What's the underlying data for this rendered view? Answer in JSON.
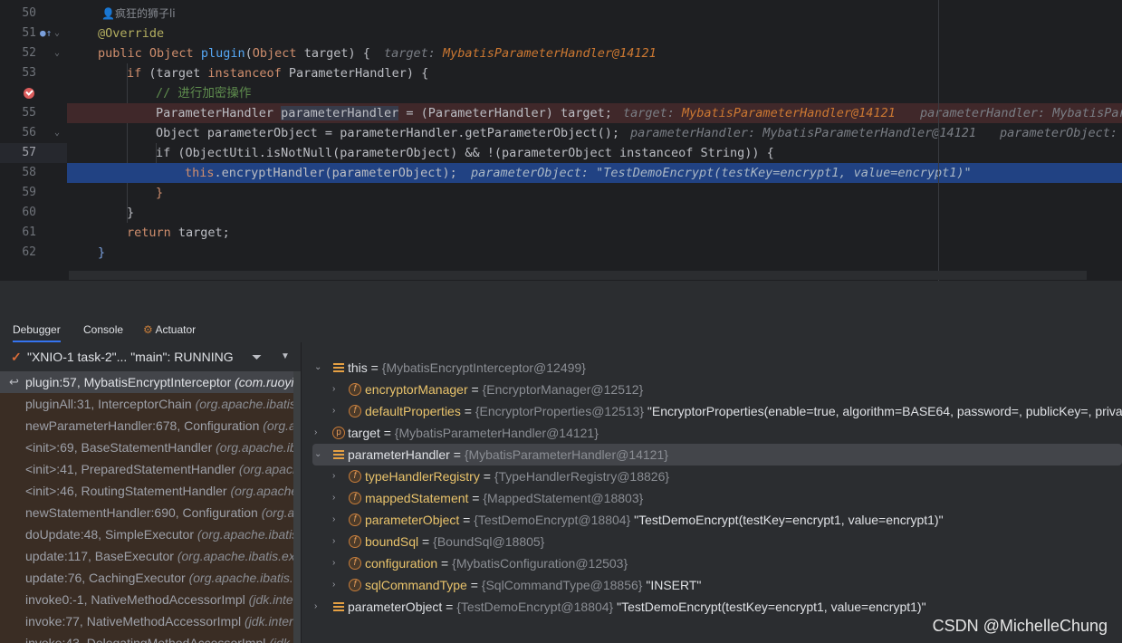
{
  "editor": {
    "author": "疯狂的狮子li",
    "line_numbers": [
      "50",
      "51",
      "52",
      "53",
      "",
      "55",
      "56",
      "57",
      "58",
      "59",
      "60",
      "61",
      "62"
    ],
    "lines": {
      "l50": {
        "annotation": "@Override"
      },
      "l51": {
        "kw_public": "public",
        "type_object": "Object",
        "method": "plugin",
        "open": "(",
        "param_type": "Object",
        "param_name": "target",
        "close": ") {",
        "hint_name": "target: ",
        "hint_value": "MybatisParameterHandler@14121"
      },
      "l52": {
        "kw_if": "if",
        "open": " (target ",
        "kw_instanceof": "instanceof",
        "type": " ParameterHandler",
        "close": ") {"
      },
      "l53": {
        "comment": "// 进行加密操作"
      },
      "l54": {
        "type": "ParameterHandler ",
        "var": "parameterHandler",
        "rest": " = (ParameterHandler) target;",
        "hint1_name": "target: ",
        "hint1_value": "MybatisParameterHandler@14121",
        "hint2": "parameterHandler: MybatisPar"
      },
      "l55": {
        "code": "Object parameterObject = parameterHandler.getParameterObject();",
        "hint1": "parameterHandler: MybatisParameterHandler@14121",
        "hint2": "parameterObject: "
      },
      "l56": {
        "code": "if (ObjectUtil.isNotNull(parameterObject) && !(parameterObject instanceof String)) {"
      },
      "l57": {
        "kw_this": "this",
        "call": ".encryptHandler(",
        "arg": "parameterObject",
        "close": ");",
        "hint": "parameterObject: \"TestDemoEncrypt(testKey=encrypt1, value=encrypt1)\""
      },
      "l58": {
        "code": "}"
      },
      "l59": {
        "code": "}"
      },
      "l60": {
        "kw_return": "return",
        "rest": " target;"
      },
      "l61": {
        "code": "}"
      }
    }
  },
  "debugger": {
    "tabs": [
      "Debugger",
      "Console",
      "Actuator"
    ],
    "thread": "\"XNIO-1 task-2\"... \"main\": RUNNING",
    "frames": [
      {
        "name": "plugin:57, MybatisEncryptInterceptor ",
        "pkg": "(com.ruoyi.d"
      },
      {
        "name": "pluginAll:31, InterceptorChain ",
        "pkg": "(org.apache.ibatis.p"
      },
      {
        "name": "newParameterHandler:678, Configuration ",
        "pkg": "(org.ap"
      },
      {
        "name": "<init>:69, BaseStatementHandler ",
        "pkg": "(org.apache.iba"
      },
      {
        "name": "<init>:41, PreparedStatementHandler ",
        "pkg": "(org.apache"
      },
      {
        "name": "<init>:46, RoutingStatementHandler ",
        "pkg": "(org.apache"
      },
      {
        "name": "newStatementHandler:690, Configuration ",
        "pkg": "(org.ap"
      },
      {
        "name": "doUpdate:48, SimpleExecutor ",
        "pkg": "(org.apache.ibatis.e"
      },
      {
        "name": "update:117, BaseExecutor ",
        "pkg": "(org.apache.ibatis.exec"
      },
      {
        "name": "update:76, CachingExecutor ",
        "pkg": "(org.apache.ibatis.ex"
      },
      {
        "name": "invoke0:-1, NativeMethodAccessorImpl ",
        "pkg": "(jdk.intern"
      },
      {
        "name": "invoke:77, NativeMethodAccessorImpl ",
        "pkg": "(jdk.intern"
      },
      {
        "name": "invoke:43, DelegatingMethodAccessorImpl ",
        "pkg": "(jdk.i"
      }
    ],
    "variables": [
      {
        "name": "this",
        "eq": " = ",
        "ref": "{MybatisEncryptInterceptor@12499}",
        "val": ""
      },
      {
        "name": "encryptorManager",
        "eq": " = ",
        "ref": "{EncryptorManager@12512}",
        "val": ""
      },
      {
        "name": "defaultProperties",
        "eq": " = ",
        "ref": "{EncryptorProperties@12513}",
        "val": " \"EncryptorProperties(enable=true, algorithm=BASE64, password=, publicKey=, private"
      },
      {
        "name": "target",
        "eq": " = ",
        "ref": "{MybatisParameterHandler@14121}",
        "val": ""
      },
      {
        "name": "parameterHandler",
        "eq": " = ",
        "ref": "{MybatisParameterHandler@14121}",
        "val": ""
      },
      {
        "name": "typeHandlerRegistry",
        "eq": " = ",
        "ref": "{TypeHandlerRegistry@18826}",
        "val": ""
      },
      {
        "name": "mappedStatement",
        "eq": " = ",
        "ref": "{MappedStatement@18803}",
        "val": ""
      },
      {
        "name": "parameterObject",
        "eq": " = ",
        "ref": "{TestDemoEncrypt@18804}",
        "val": " \"TestDemoEncrypt(testKey=encrypt1, value=encrypt1)\""
      },
      {
        "name": "boundSql",
        "eq": " = ",
        "ref": "{BoundSql@18805}",
        "val": ""
      },
      {
        "name": "configuration",
        "eq": " = ",
        "ref": "{MybatisConfiguration@12503}",
        "val": ""
      },
      {
        "name": "sqlCommandType",
        "eq": " = ",
        "ref": "{SqlCommandType@18856}",
        "val": " \"INSERT\""
      },
      {
        "name": "parameterObject",
        "eq": " = ",
        "ref": "{TestDemoEncrypt@18804}",
        "val": " \"TestDemoEncrypt(testKey=encrypt1, value=encrypt1)\""
      }
    ],
    "watermark": "CSDN @MichelleChung"
  },
  "colors": {
    "accent": "#3574f0",
    "current_line": "#214283",
    "breakpoint": "#db5c5c"
  }
}
